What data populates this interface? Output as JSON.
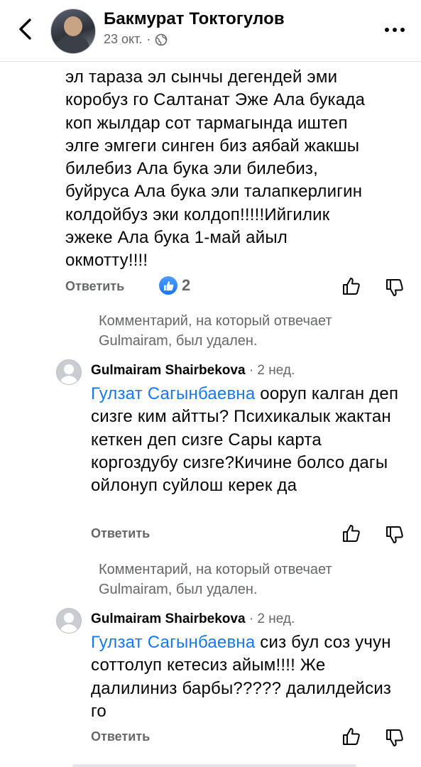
{
  "header": {
    "author": "Бакмурат Токтогулов",
    "date": "23 окт.",
    "separator": "·"
  },
  "main_comment": {
    "lines": [
      "эл тараза эл сынчы дегендей эми",
      "коробуз го Салтанат Эже Ала букада",
      "коп жылдар сот тармагында иштеп",
      "элге эмгеги синген биз аябай жакшы",
      "билебиз Ала бука эли билебиз,",
      "буйруса Ала бука эли талапкерлигин",
      "колдойбуз эки колдоп!!!!!Ийгилик",
      "эжеке Ала бука 1-май айыл",
      "окмотту!!!!"
    ],
    "reply_label": "Ответить",
    "like_count": "2"
  },
  "replies": [
    {
      "deleted_notice": "Комментарий, на который отвечает Gulmairam, был удален.",
      "name": "Gulmairam Shairbekova",
      "time": " · 2 нед.",
      "mention": "Гулзат Сагынбаевна",
      "text": " ооруп калган деп сизге ким айтты? Психикалык жактан кеткен деп сизге Сары карта коргоздубу сизге?Кичине болсо дагы ойлонуп суйлош керек да",
      "reply_label": "Ответить"
    },
    {
      "deleted_notice": "Комментарий, на который отвечает Gulmairam, был удален.",
      "name": "Gulmairam Shairbekova",
      "time": " · 2 нед.",
      "mention": "Гулзат Сагынбаевна",
      "text": " сиз бул соз учун соттолуп кетесиз айым!!!! Же далилиниз барбы????? далилдейсиз го",
      "reply_label": "Ответить"
    }
  ],
  "icons": {
    "back": "chevron-left-icon",
    "more": "more-dots-icon",
    "audience": "globe-icon",
    "like": "thumbs-up-icon",
    "dislike": "thumbs-down-icon"
  },
  "colors": {
    "link": "#1877f2",
    "secondary": "#65676b"
  }
}
